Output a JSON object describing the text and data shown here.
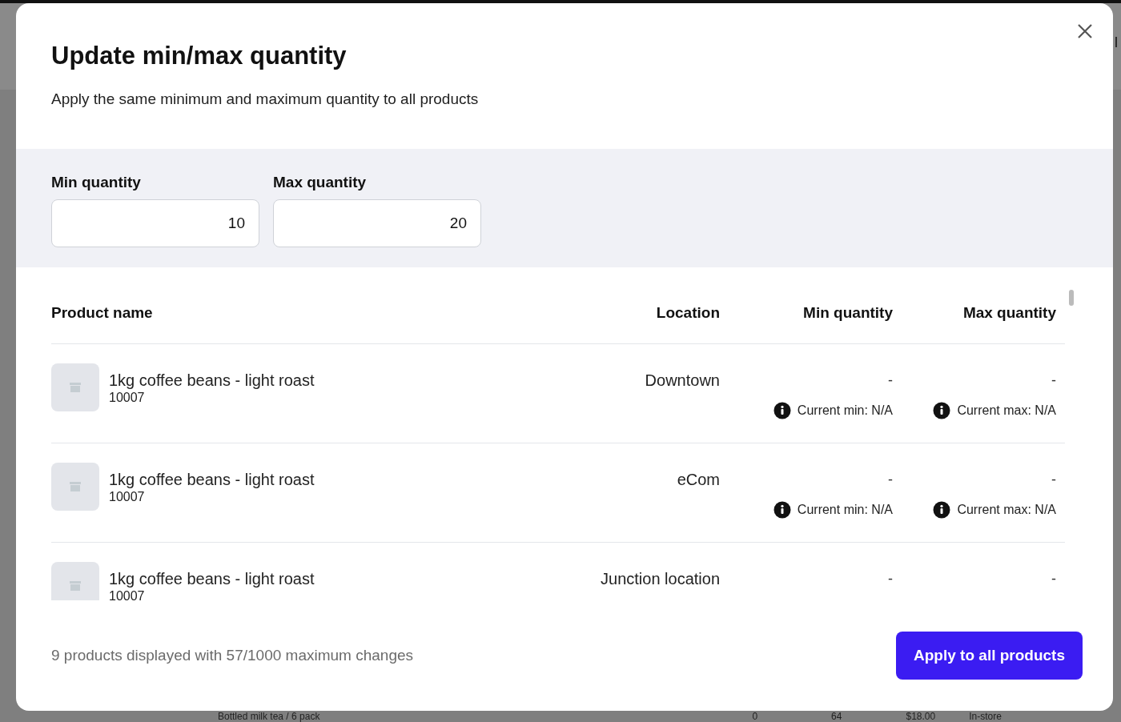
{
  "background": {
    "header_text": "l",
    "row": {
      "name": "Bottled milk tea / 6 pack",
      "cells": [
        "0",
        "64",
        "$18.00",
        "In-store"
      ]
    }
  },
  "dialog": {
    "title": "Update min/max quantity",
    "subtitle": "Apply the same minimum and maximum quantity to all products",
    "fields": [
      {
        "label": "Min quantity",
        "value": "10"
      },
      {
        "label": "Max quantity",
        "value": "20"
      }
    ],
    "table": {
      "columns": [
        "Product name",
        "Location",
        "Min quantity",
        "Max quantity"
      ],
      "rows": [
        {
          "name": "1kg coffee beans - light roast",
          "sku": "10007",
          "location": "Downtown",
          "min": "-",
          "max": "-",
          "current_min": "Current min: N/A",
          "current_max": "Current max: N/A"
        },
        {
          "name": "1kg coffee beans - light roast",
          "sku": "10007",
          "location": "eCom",
          "min": "-",
          "max": "-",
          "current_min": "Current min: N/A",
          "current_max": "Current max: N/A"
        },
        {
          "name": "1kg coffee beans - light roast",
          "sku": "10007",
          "location": "Junction location",
          "min": "-",
          "max": "-"
        }
      ]
    },
    "footer_text": "9 products displayed with 57/1000 maximum changes",
    "apply_button": "Apply to all products"
  }
}
